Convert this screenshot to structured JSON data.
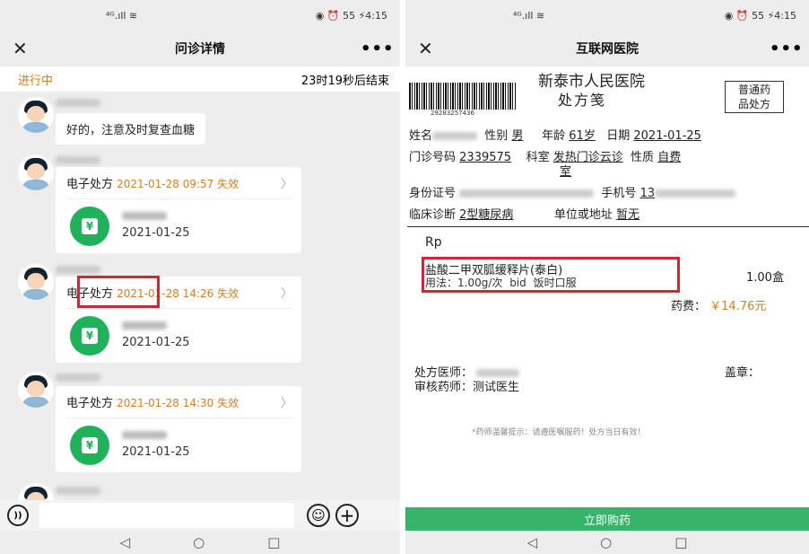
{
  "left": {
    "status": {
      "signal": "⁴ᴳ.ıll ≋",
      "right": "◉ ⏰ 55 ⚡4:15"
    },
    "title": "问诊详情",
    "close": "✕",
    "more": "•••",
    "progress_state": "进行中",
    "progress_remaining": "23时19秒后结束",
    "first_message": "好的，注意及时复查血糖",
    "prescriptions": [
      {
        "label": "电子处方",
        "time": "2021-01-28 09:57 失效",
        "date": "2021-01-25"
      },
      {
        "label": "电子处方",
        "time": "2021-01-28 14:26 失效",
        "date": "2021-01-25"
      },
      {
        "label": "电子处方",
        "time": "2021-01-28 14:30 失效",
        "date": "2021-01-25"
      }
    ],
    "rx_icon": "¥",
    "chev": "〉",
    "voice": "))",
    "emoji": "☺",
    "plus": "+"
  },
  "right": {
    "status": {
      "signal": "⁴ᴳ.ıll ≋",
      "right": "◉ ⏰ 55 ⚡4:15"
    },
    "title": "互联网医院",
    "close": "✕",
    "more": "•••",
    "hospital": "新泰市人民医院",
    "doc_title": "处方笺",
    "barcode_number": "29283257436",
    "rx_type_line1": "普通药",
    "rx_type_line2": "品处方",
    "name_label": "姓名",
    "gender_label": "性别",
    "gender": "男",
    "age_label": "年龄",
    "age": "61岁",
    "date_label": "日期",
    "date": "2021-01-25",
    "clinic_no_label": "门诊号码",
    "clinic_no": "2339575",
    "dept_label": "科室",
    "dept": "发热门诊云诊",
    "nature_label": "性质",
    "nature": "自费",
    "nature_wrap": "室",
    "id_label": "身份证号",
    "phone_label": "手机号",
    "phone_prefix": "13",
    "diagnosis_label": "临床诊断",
    "diagnosis": "2型糖尿病",
    "unit_label": "单位或地址",
    "unit": "暂无",
    "rp": "Rp",
    "drug": "盐酸二甲双胍缓释片(泰白)",
    "usage": "用法：1.00g/次  bid  饭时口服",
    "qty": "1.00盒",
    "fee_label": "药费：",
    "fee": "￥14.76元",
    "doctor_label": "处方医师：",
    "seal_label": "盖章：",
    "pharmacist_label": "审核药师：",
    "pharmacist": "测试医生",
    "tip": "*药师温馨提示：请遵医嘱服药！处方当日有效！",
    "buy": "立即购药"
  },
  "nav": {
    "back": "◁",
    "home": "○",
    "recent": "□"
  }
}
